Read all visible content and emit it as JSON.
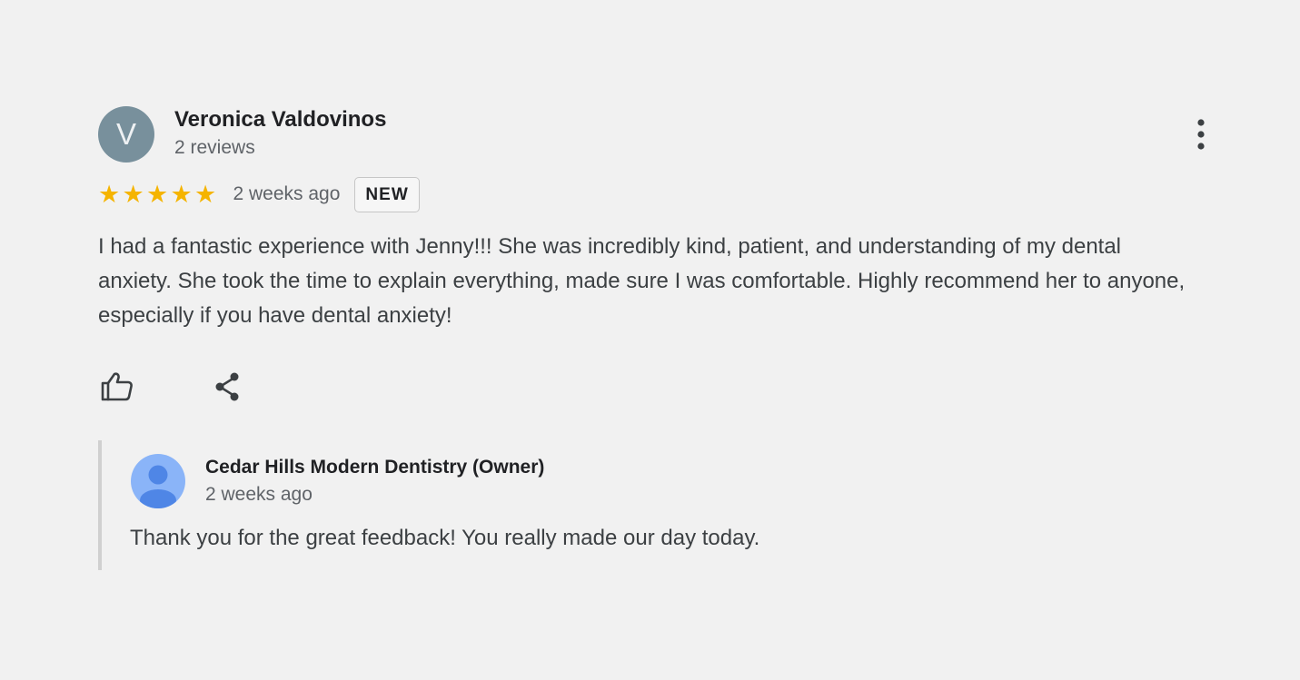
{
  "review": {
    "avatar_initial": "V",
    "author_name": "Veronica Valdovinos",
    "author_meta": "2 reviews",
    "rating": 5,
    "rating_max": 5,
    "star_glyph": "★",
    "time_ago": "2 weeks ago",
    "badge": "NEW",
    "text": "I had a fantastic experience with Jenny!!! She was incredibly kind, patient, and understanding of my dental anxiety. She took the time to explain everything, made sure I was comfortable. Highly recommend her to anyone, especially if you have dental anxiety!"
  },
  "icons": {
    "more": "more-vertical-icon",
    "like": "thumbs-up-icon",
    "share": "share-icon",
    "owner_avatar": "person-avatar-icon"
  },
  "owner_response": {
    "name": "Cedar Hills Modern Dentistry (Owner)",
    "time_ago": "2 weeks ago",
    "text": "Thank you for the great feedback! You really made our day today."
  },
  "colors": {
    "background": "#f1f1f1",
    "star": "#f5b400",
    "avatar": "#78909c",
    "owner_avatar_bg": "#8ab4f8",
    "owner_avatar_fg": "#4f86e6"
  }
}
